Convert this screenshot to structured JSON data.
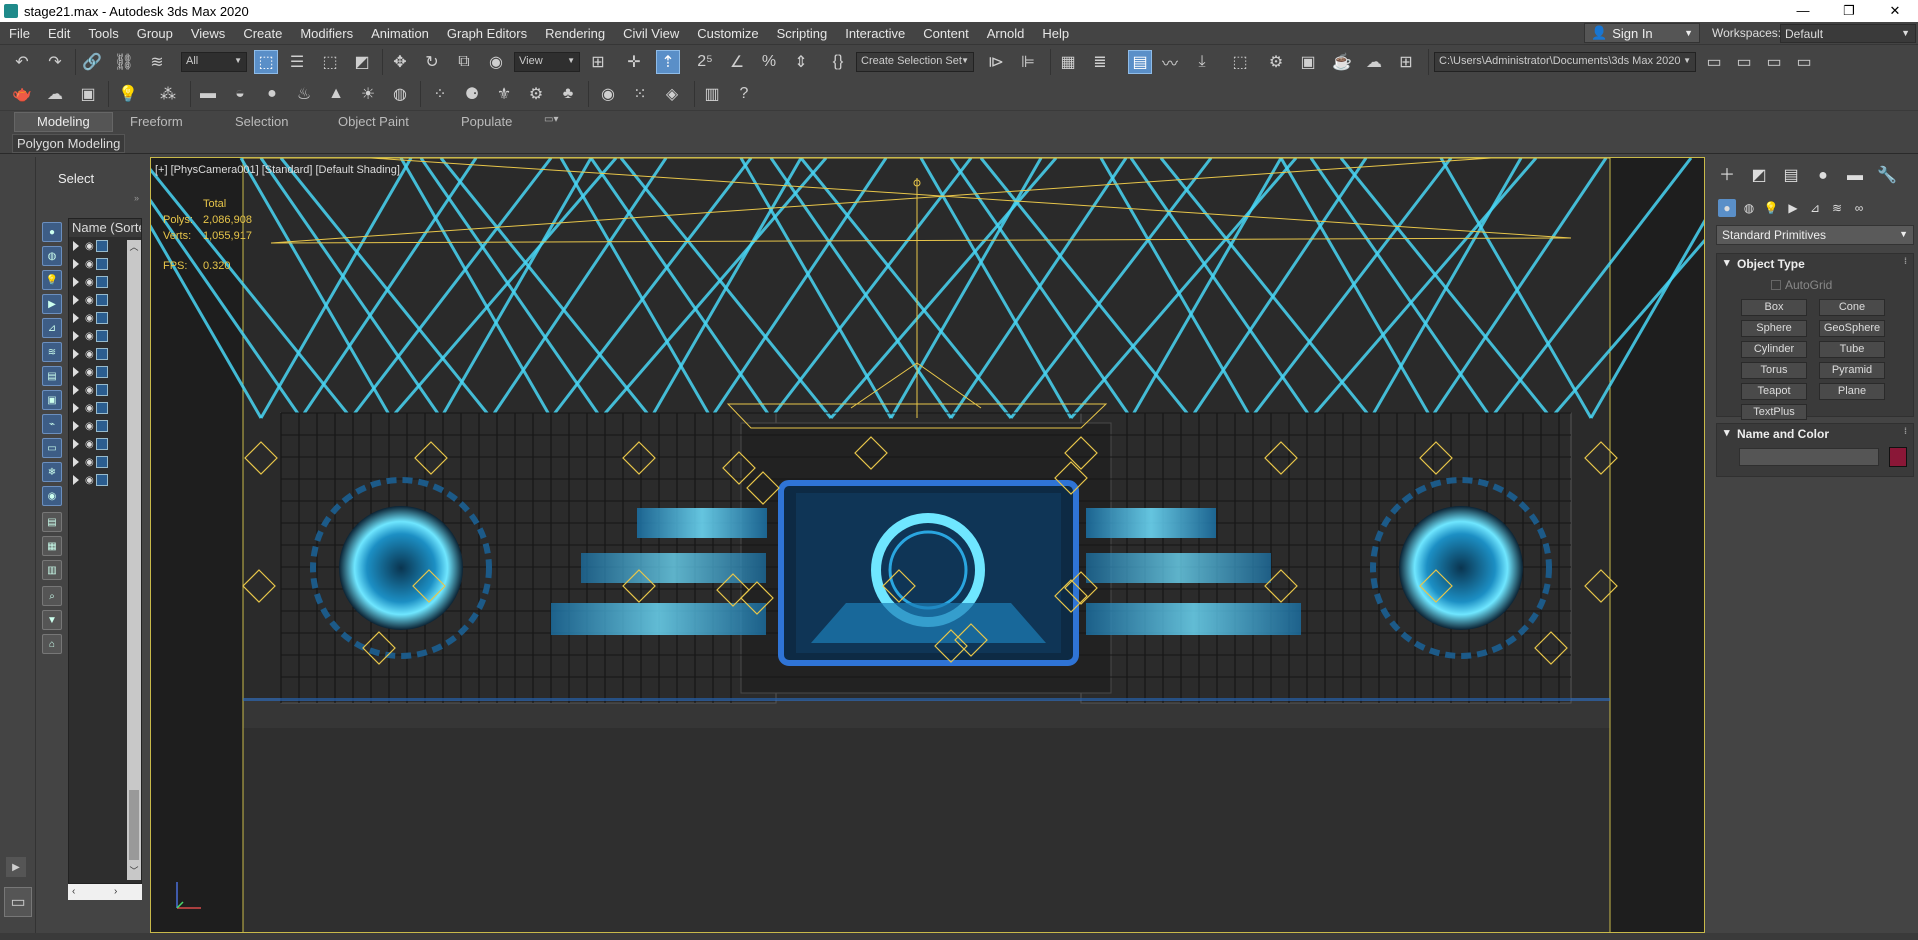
{
  "window": {
    "title": "stage21.max - Autodesk 3ds Max 2020",
    "controls": [
      "—",
      "❐",
      "✕"
    ]
  },
  "menu": [
    "File",
    "Edit",
    "Tools",
    "Group",
    "Views",
    "Create",
    "Modifiers",
    "Animation",
    "Graph Editors",
    "Rendering",
    "Civil View",
    "Customize",
    "Scripting",
    "Interactive",
    "Content",
    "Arnold",
    "Help"
  ],
  "account": {
    "sign_in": "Sign In",
    "workspaces_label": "Workspaces:",
    "workspace": "Default"
  },
  "toolbar": {
    "selection_filter": "All",
    "reference_coord": "View",
    "named_selection": "Create Selection Set",
    "project_path": "C:\\Users\\Administrator\\Documents\\3ds Max 2020"
  },
  "ribbon": {
    "tabs": [
      "Modeling",
      "Freeform",
      "Selection",
      "Object Paint",
      "Populate"
    ],
    "active_tab": "Modeling",
    "panel": "Polygon Modeling"
  },
  "explorer": {
    "select_label": "Select",
    "column_header": "Name (Sorted Ascending)",
    "row_count": 14
  },
  "viewport": {
    "label": "[+] [PhysCamera001] [Standard] [Default Shading]",
    "stats": {
      "header": "Total",
      "polys_label": "Polys:",
      "polys": "2,086,908",
      "verts_label": "Verts:",
      "verts": "1,055,917",
      "fps_label": "FPS:",
      "fps": "0.320"
    }
  },
  "command_panel": {
    "category": "Standard Primitives",
    "object_type_title": "Object Type",
    "autogrid_label": "AutoGrid",
    "buttons": [
      "Box",
      "Cone",
      "Sphere",
      "GeoSphere",
      "Cylinder",
      "Tube",
      "Torus",
      "Pyramid",
      "Teapot",
      "Plane",
      "TextPlus"
    ],
    "name_color_title": "Name and Color",
    "object_color": "#8a1737"
  },
  "colors": {
    "beam": "#49d6f5",
    "selection_outline": "#e8c64a",
    "ui_bg": "#444444",
    "active_blue": "#5a8fc8"
  }
}
